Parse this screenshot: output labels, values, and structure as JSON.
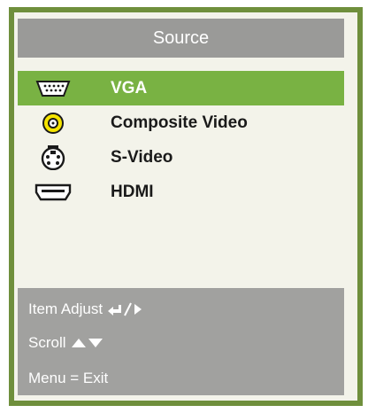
{
  "menu": {
    "title": "Source",
    "items": [
      {
        "label": "VGA",
        "icon": "vga-icon",
        "selected": true
      },
      {
        "label": "Composite Video",
        "icon": "composite-video-icon",
        "selected": false
      },
      {
        "label": "S-Video",
        "icon": "s-video-icon",
        "selected": false
      },
      {
        "label": "HDMI",
        "icon": "hdmi-icon",
        "selected": false
      }
    ]
  },
  "footer": {
    "item_adjust": "Item Adjust",
    "scroll": "Scroll",
    "menu_exit": "Menu = Exit"
  },
  "colors": {
    "frame": "#6f8f3c",
    "panel": "#f3f3ea",
    "header": "#9a9a98",
    "selected": "#79b243",
    "footer": "#a1a19f"
  }
}
